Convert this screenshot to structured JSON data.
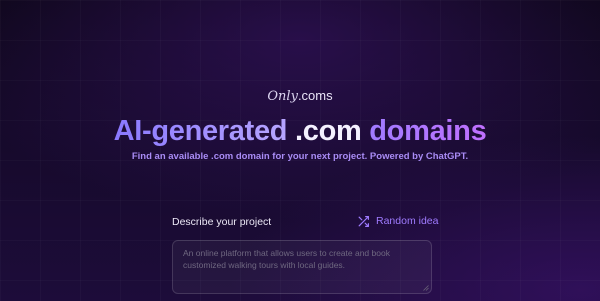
{
  "logo": {
    "only": "Only",
    "coms": ".coms"
  },
  "hero": {
    "title_part1": "AI-generated",
    "title_part2": ".com",
    "title_part3": "domains",
    "subtitle": "Find an available .com domain for your next project. Powered by ChatGPT."
  },
  "form": {
    "describe_label": "Describe your project",
    "random_idea_label": "Random idea",
    "random_idea_icon": "shuffle-icon",
    "textarea_placeholder": "An online platform that allows users to create and book customized walking tours with local guides."
  },
  "colors": {
    "accent": "#9f7bff",
    "title_gradient_start": "#8a78ff",
    "domains_gradient_end": "#c070ff",
    "background": "#160a2b"
  }
}
